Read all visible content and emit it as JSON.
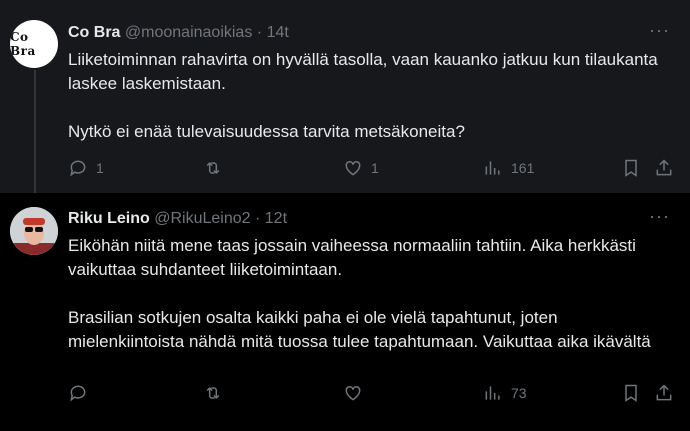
{
  "tweets": [
    {
      "name": "Co Bra",
      "handle": "@moonainaoikias",
      "dot": "·",
      "time": "14t",
      "avatar_text": "Co Bra",
      "paragraphs": [
        "Liiketoiminnan rahavirta on hyvällä tasolla, vaan kauanko jatkuu kun tilaukanta laskee laskemistaan.",
        "Nytkö ei enää tulevaisuudessa tarvita metsäkoneita?"
      ],
      "replies": "1",
      "reposts": "",
      "likes": "1",
      "views": "161",
      "more": "···"
    },
    {
      "name": "Riku Leino",
      "handle": "@RikuLeino2",
      "dot": "·",
      "time": "12t",
      "paragraphs": [
        "Eiköhän niitä mene taas jossain vaiheessa normaaliin tahtiin. Aika herkkästi vaikuttaa suhdanteet liiketoimintaan.",
        "Brasilian sotkujen osalta kaikki paha ei ole vielä tapahtunut, joten mielenkiintoista nähdä mitä tuossa tulee tapahtumaan. Vaikuttaa aika ikävältä"
      ],
      "replies": "",
      "reposts": "",
      "likes": "",
      "views": "73",
      "more": "···"
    }
  ],
  "colors": {
    "background": "#000000",
    "highlight": "#16181c",
    "text": "#e7e9ea",
    "muted": "#71767b"
  },
  "icons": [
    "reply-icon",
    "repost-icon",
    "like-icon",
    "views-icon",
    "bookmark-icon",
    "share-icon",
    "more-icon"
  ]
}
